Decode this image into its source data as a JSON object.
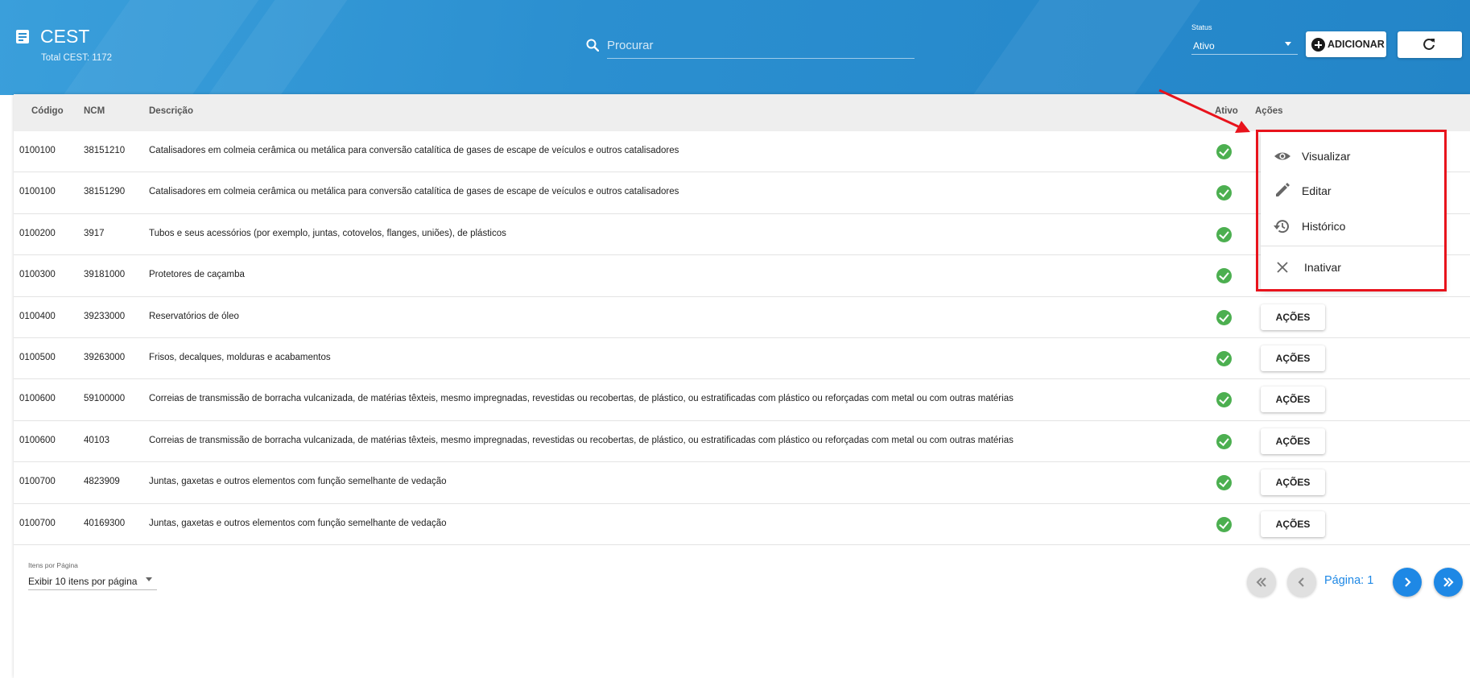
{
  "header": {
    "title": "CEST",
    "subtitle": "Total CEST: 1172",
    "search_placeholder": "Procurar",
    "status_label": "Status",
    "status_value": "Ativo",
    "add_label": "ADICIONAR",
    "accent_color": "#2b8fd0"
  },
  "table": {
    "columns": [
      "Código",
      "NCM",
      "Descrição",
      "Ativo",
      "Ações"
    ],
    "rows": [
      {
        "codigo": "0100100",
        "ncm": "38151210",
        "descricao": "Catalisadores em colmeia cerâmica ou metálica para conversão catalítica de gases de escape de veículos e outros catalisadores",
        "ativo": true
      },
      {
        "codigo": "0100100",
        "ncm": "38151290",
        "descricao": "Catalisadores em colmeia cerâmica ou metálica para conversão catalítica de gases de escape de veículos e outros catalisadores",
        "ativo": true
      },
      {
        "codigo": "0100200",
        "ncm": "3917",
        "descricao": "Tubos e seus acessórios (por exemplo, juntas, cotovelos, flanges, uniões), de plásticos",
        "ativo": true
      },
      {
        "codigo": "0100300",
        "ncm": "39181000",
        "descricao": "Protetores de caçamba",
        "ativo": true
      },
      {
        "codigo": "0100400",
        "ncm": "39233000",
        "descricao": "Reservatórios de óleo",
        "ativo": true
      },
      {
        "codigo": "0100500",
        "ncm": "39263000",
        "descricao": "Frisos, decalques, molduras e acabamentos",
        "ativo": true
      },
      {
        "codigo": "0100600",
        "ncm": "59100000",
        "descricao": "Correias de transmissão de borracha vulcanizada, de matérias têxteis, mesmo impregnadas, revestidas ou recobertas, de plástico, ou estratificadas com plástico ou reforçadas com metal ou com outras matérias",
        "ativo": true
      },
      {
        "codigo": "0100600",
        "ncm": "40103",
        "descricao": "Correias de transmissão de borracha vulcanizada, de matérias têxteis, mesmo impregnadas, revestidas ou recobertas, de plástico, ou estratificadas com plástico ou reforçadas com metal ou com outras matérias",
        "ativo": true
      },
      {
        "codigo": "0100700",
        "ncm": "4823909",
        "descricao": "Juntas, gaxetas e outros elementos com função semelhante de vedação",
        "ativo": true
      },
      {
        "codigo": "0100700",
        "ncm": "40169300",
        "descricao": "Juntas, gaxetas e outros elementos com função semelhante de vedação",
        "ativo": true
      }
    ],
    "action_label": "AÇÕES",
    "check_color": "#4caf50"
  },
  "menu": {
    "items": [
      {
        "label": "Visualizar",
        "icon": "eye-icon"
      },
      {
        "label": "Editar",
        "icon": "pencil-icon"
      },
      {
        "label": "Histórico",
        "icon": "history-icon"
      },
      {
        "label": "Inativar",
        "icon": "close-icon"
      }
    ],
    "highlight_color": "#e8131c"
  },
  "pagination": {
    "items_label": "Itens por Página",
    "items_value": "Exibir 10 itens por página",
    "page_label": "Página: 1",
    "active_color": "#1e88e5"
  }
}
